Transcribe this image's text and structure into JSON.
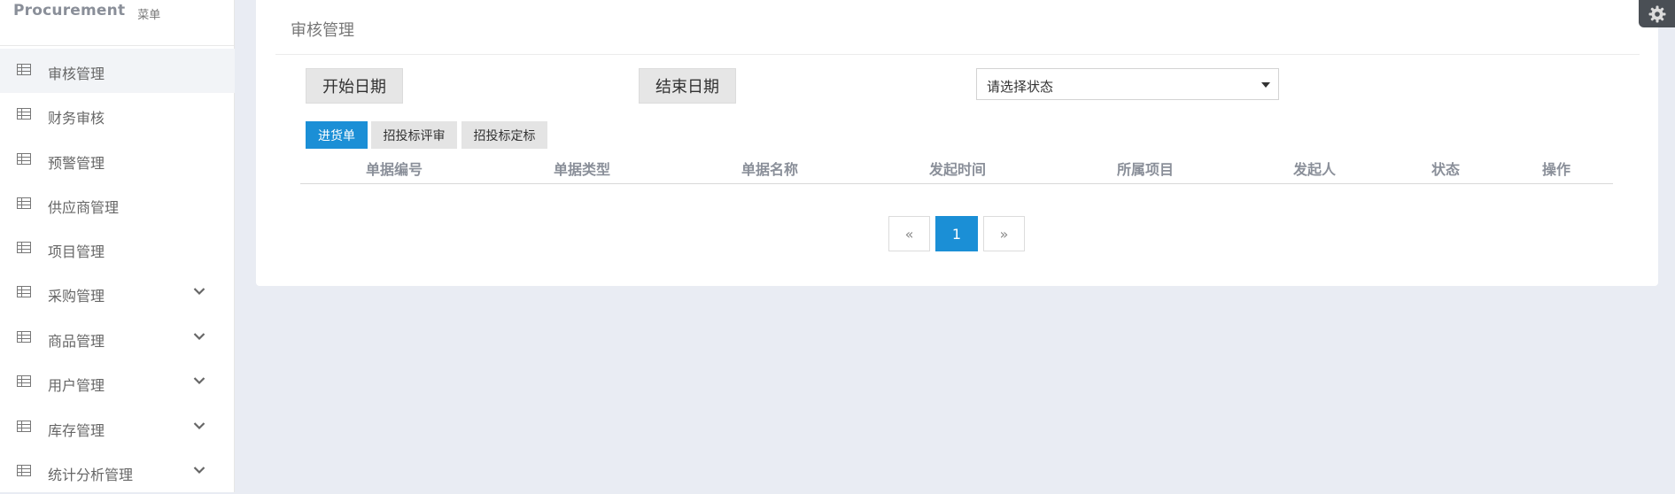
{
  "brand": {
    "name": "Procurement",
    "sub": "菜单"
  },
  "sidebar": {
    "items": [
      {
        "label": "审核管理",
        "has_children": false,
        "active": true
      },
      {
        "label": "财务审核",
        "has_children": false,
        "active": false
      },
      {
        "label": "预警管理",
        "has_children": false,
        "active": false
      },
      {
        "label": "供应商管理",
        "has_children": false,
        "active": false
      },
      {
        "label": "项目管理",
        "has_children": false,
        "active": false
      },
      {
        "label": "采购管理",
        "has_children": true,
        "active": false
      },
      {
        "label": "商品管理",
        "has_children": true,
        "active": false
      },
      {
        "label": "用户管理",
        "has_children": true,
        "active": false
      },
      {
        "label": "库存管理",
        "has_children": true,
        "active": false
      },
      {
        "label": "统计分析管理",
        "has_children": true,
        "active": false
      }
    ]
  },
  "main": {
    "title": "审核管理",
    "start_date_label": "开始日期",
    "end_date_label": "结束日期",
    "status_select": {
      "placeholder": "请选择状态"
    },
    "tabs": [
      {
        "label": "进货单",
        "active": true
      },
      {
        "label": "招投标评审",
        "active": false
      },
      {
        "label": "招投标定标",
        "active": false
      }
    ],
    "table": {
      "columns": [
        "单据编号",
        "单据类型",
        "单据名称",
        "发起时间",
        "所属项目",
        "发起人",
        "状态",
        "操作"
      ],
      "rows": []
    },
    "pagination": {
      "prev": "«",
      "current": "1",
      "next": "»"
    }
  },
  "colors": {
    "accent": "#1b8fd6",
    "background": "#e9ecf3",
    "gear_bg": "#4a4f55"
  }
}
